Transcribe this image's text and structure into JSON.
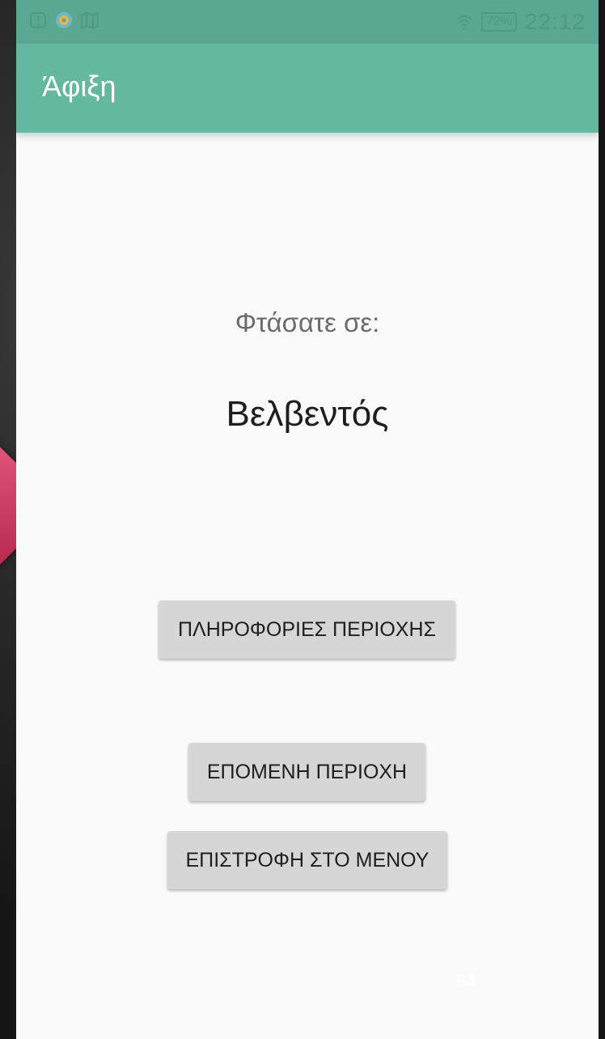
{
  "status_bar": {
    "icons_left": [
      "notification-icon",
      "compass-app-icon",
      "map-icon"
    ],
    "wifi_icon": "wifi-icon",
    "battery_level": "72%",
    "time": "22:12"
  },
  "app_bar": {
    "title": "Άφιξη"
  },
  "main": {
    "arrived_label": "Φτάσατε σε:",
    "place_name": "Βελβεντός"
  },
  "buttons": {
    "area_info": "ΠΛΗΡΟΦΟΡΙΕΣ ΠΕΡΙΟΧΗΣ",
    "next_area": "ΕΠΟΜΕΝΗ ΠΕΡΙΟΧΗ",
    "back_to_menu": "ΕΠΙΣΤΡΟΦΗ ΣΤΟ ΜΕΝΟΥ"
  },
  "slide": {
    "page_number": "84"
  },
  "colors": {
    "status_bar": "#5aa892",
    "app_bar": "#64b8a0",
    "button": "#d6d6d6",
    "background": "#fafafa",
    "arrow_accent": "#c93a63"
  }
}
